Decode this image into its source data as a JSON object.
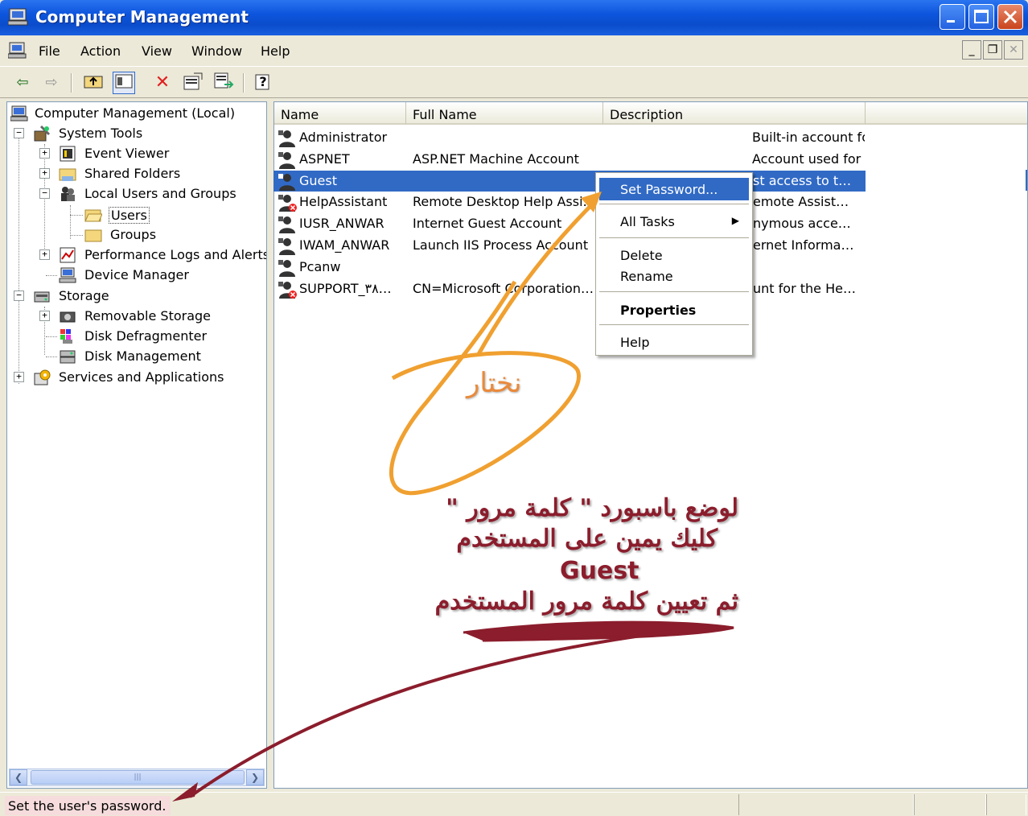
{
  "window": {
    "title": "Computer Management"
  },
  "menu": [
    "File",
    "Action",
    "View",
    "Window",
    "Help"
  ],
  "tree": [
    {
      "label": "Computer Management (Local)",
      "icon": "computer-icon"
    },
    {
      "label": "System Tools",
      "icon": "tools-icon"
    },
    {
      "label": "Event Viewer",
      "icon": "event-viewer-icon"
    },
    {
      "label": "Shared Folders",
      "icon": "shared-folder-icon"
    },
    {
      "label": "Local Users and Groups",
      "icon": "users-groups-icon"
    },
    {
      "label": "Users",
      "icon": "folder-open-icon"
    },
    {
      "label": "Groups",
      "icon": "folder-icon"
    },
    {
      "label": "Performance Logs and Alerts",
      "icon": "performance-icon"
    },
    {
      "label": "Device Manager",
      "icon": "device-manager-icon"
    },
    {
      "label": "Storage",
      "icon": "storage-icon"
    },
    {
      "label": "Removable Storage",
      "icon": "removable-storage-icon"
    },
    {
      "label": "Disk Defragmenter",
      "icon": "defrag-icon"
    },
    {
      "label": "Disk Management",
      "icon": "disk-management-icon"
    },
    {
      "label": "Services and Applications",
      "icon": "services-icon"
    }
  ],
  "columns": [
    "Name",
    "Full Name",
    "Description"
  ],
  "users": [
    {
      "name": "Administrator",
      "full": "",
      "desc": "Built-in account for administering the…",
      "disabled": false
    },
    {
      "name": "ASPNET",
      "full": "ASP.NET Machine Account",
      "desc": "Account used for running the ASP.N…",
      "disabled": false
    },
    {
      "name": "Guest",
      "full": "",
      "desc": "st access to t…",
      "disabled": false
    },
    {
      "name": "HelpAssistant",
      "full": "Remote Desktop Help Assi…",
      "desc": "emote Assist…",
      "disabled": true
    },
    {
      "name": "IUSR_ANWAR",
      "full": "Internet Guest Account",
      "desc": "nymous acce…",
      "disabled": false
    },
    {
      "name": "IWAM_ANWAR",
      "full": "Launch IIS Process Account",
      "desc": "ernet Informa…",
      "disabled": false
    },
    {
      "name": "Pcanw",
      "full": "",
      "desc": "",
      "disabled": false
    },
    {
      "name": "SUPPORT_٣٨…",
      "full": "CN=Microsoft Corporation…",
      "desc": "unt for the He…",
      "disabled": true
    }
  ],
  "context_menu": {
    "set_password": "Set Password...",
    "all_tasks": "All Tasks",
    "delete": "Delete",
    "rename": "Rename",
    "properties": "Properties",
    "help": "Help"
  },
  "status": {
    "text": "Set the user's password."
  },
  "annotations": {
    "choose": "نختار",
    "line1": "لوضع باسبورد \" كلمة مرور \"",
    "line2": "كليك يمين على المستخدم",
    "guest": "Guest",
    "line3": "ثم تعيين كلمة مرور المستخدم"
  },
  "colors": {
    "selection": "#316AC5",
    "annotation_arrow": "#8B1D2C",
    "annotation_orange": "#F0A030"
  }
}
